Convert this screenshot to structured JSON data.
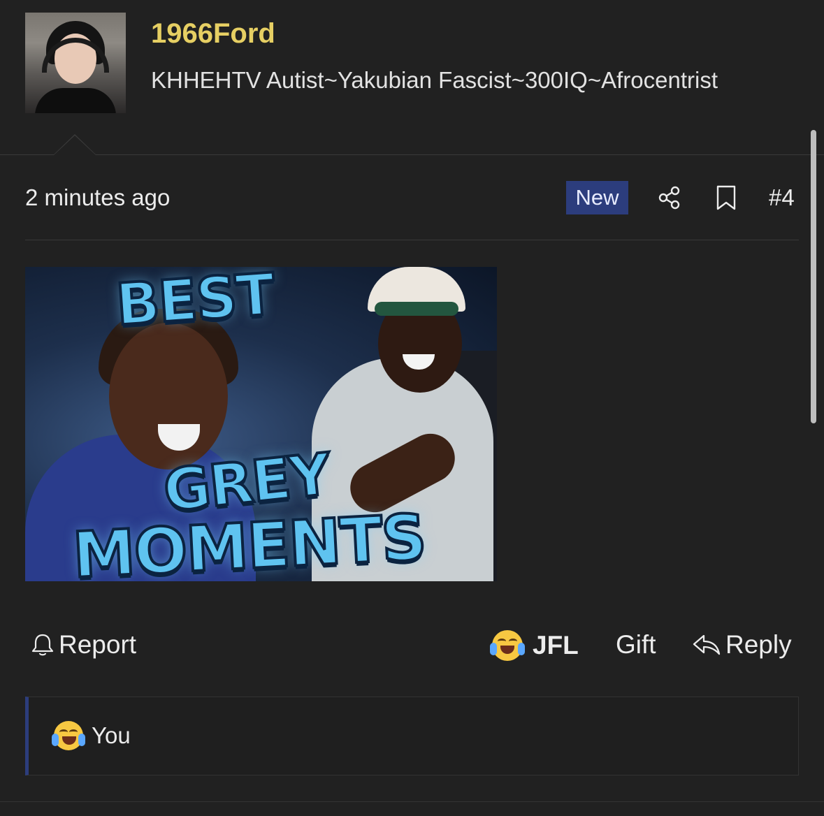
{
  "post": {
    "username": "1966Ford",
    "user_title": "KHHEHTV Autist~Yakubian Fascist~300IQ~Afrocentrist",
    "timestamp": "2 minutes ago",
    "badge": "New",
    "post_number": "#4",
    "image_text": {
      "line1": "BEST",
      "line2": "GREY",
      "line3": "MOMENTS"
    }
  },
  "actions": {
    "report": "Report",
    "jfl": "JFL",
    "gift": "Gift",
    "reply": "Reply"
  },
  "reactions": [
    {
      "emoji": "joy-icon",
      "label": "You"
    }
  ],
  "colors": {
    "background": "#212121",
    "username": "#e6cf63",
    "accent": "#2c3d7d"
  }
}
